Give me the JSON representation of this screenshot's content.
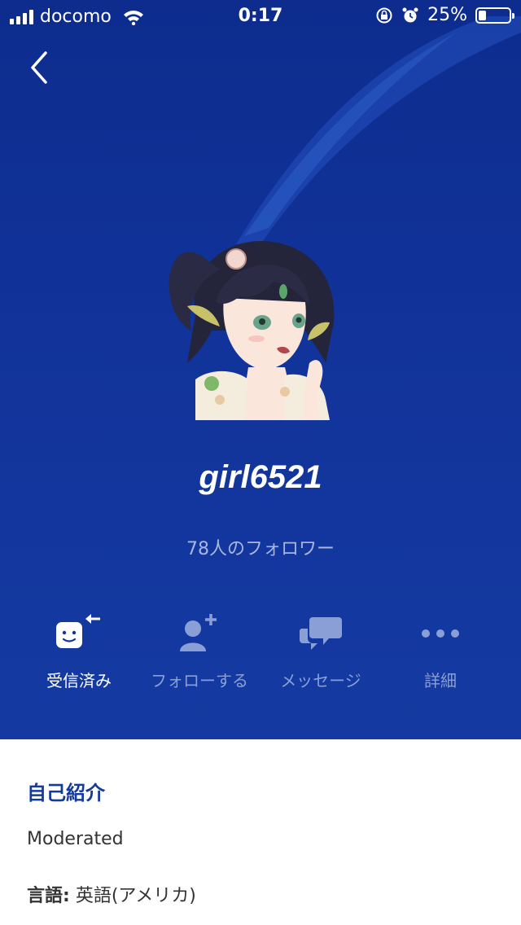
{
  "status_bar": {
    "carrier": "docomo",
    "time": "0:17",
    "battery_percent": "25%",
    "battery_level": 0.25
  },
  "profile": {
    "username": "girl6521",
    "followers_text": "78人のフォロワー"
  },
  "actions": [
    {
      "label": "受信済み",
      "icon": "received-icon",
      "active": true
    },
    {
      "label": "フォローする",
      "icon": "follow-icon",
      "active": false
    },
    {
      "label": "メッセージ",
      "icon": "message-icon",
      "active": false
    },
    {
      "label": "詳細",
      "icon": "more-icon",
      "active": false
    }
  ],
  "bio": {
    "title": "自己紹介",
    "text": "Moderated",
    "language_label": "言語:",
    "language_value": "英語(アメリカ)"
  },
  "colors": {
    "hero_bg": "#11339a",
    "accent": "#143a9c",
    "inactive_label": "#8a9fd6"
  }
}
